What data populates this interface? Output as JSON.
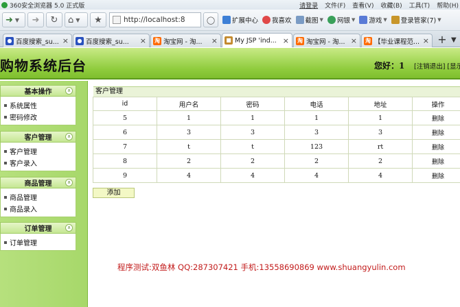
{
  "browser": {
    "app_title": "360安全浏览器 5.0 正式版",
    "login_user": "请登录",
    "menu": [
      "文件(F)",
      "查看(V)",
      "收藏(B)",
      "工具(T)",
      "帮助(H)"
    ],
    "address": "http://localhost:8",
    "toolbar": [
      {
        "label": "扩展中心",
        "color": "#3d7fd6"
      },
      {
        "label": "我喜欢",
        "color": "#e04848"
      },
      {
        "label": "截图",
        "color": "#7a9bc4"
      },
      {
        "label": "网银",
        "color": "#3aa05a"
      },
      {
        "label": "游戏",
        "color": "#5a7bd6"
      },
      {
        "label": "登录管家(7)",
        "color": "#c8962a"
      }
    ],
    "tabs": [
      {
        "label": "百度搜索_su...",
        "icon": "paw-icon",
        "color": "#2a52be"
      },
      {
        "label": "百度搜索_su...",
        "icon": "paw-icon",
        "color": "#2a52be"
      },
      {
        "label": "淘宝网 - 淘...",
        "icon": "taobao-icon",
        "color": "#ff6a00"
      },
      {
        "label": "My JSP 'ind...",
        "icon": "jsp-page-icon",
        "color": "#c38a2e"
      },
      {
        "label": "淘宝网 - 淘...",
        "icon": "taobao-icon",
        "color": "#ff6a00"
      },
      {
        "label": "【毕业课程范...",
        "icon": "taobao-icon",
        "color": "#ff6a00"
      }
    ],
    "new_tab": "+"
  },
  "header": {
    "title": "购物系统后台",
    "greeting": "您好：1",
    "links": "[注销退出] [显示"
  },
  "sidebar": {
    "groups": [
      {
        "title": "基本操作",
        "items": [
          "系统属性",
          "密码修改"
        ]
      },
      {
        "title": "客户管理",
        "items": [
          "客户管理",
          "客户录入"
        ]
      },
      {
        "title": "商品管理",
        "items": [
          "商品管理",
          "商品录入"
        ]
      },
      {
        "title": "订单管理",
        "items": [
          "订单管理"
        ]
      }
    ]
  },
  "main": {
    "panel_title": "客户管理",
    "columns": [
      "id",
      "用户名",
      "密码",
      "电话",
      "地址",
      "操作"
    ],
    "rows": [
      [
        "5",
        "1",
        "1",
        "1",
        "1",
        "删除"
      ],
      [
        "6",
        "3",
        "3",
        "3",
        "3",
        "删除"
      ],
      [
        "7",
        "t",
        "t",
        "123",
        "rt",
        "删除"
      ],
      [
        "8",
        "2",
        "2",
        "2",
        "2",
        "删除"
      ],
      [
        "9",
        "4",
        "4",
        "4",
        "4",
        "删除"
      ]
    ],
    "add_button": "添加",
    "footer_note": "程序测试:双鱼林 QQ:287307421 手机:13558690869 www.shuangyulin.com"
  }
}
